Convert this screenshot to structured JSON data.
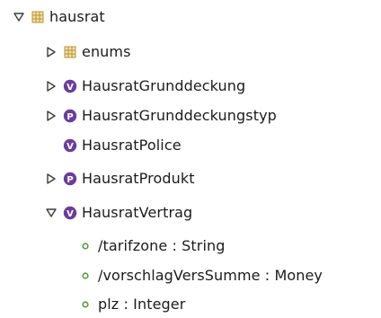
{
  "tree": {
    "root": {
      "label": "hausrat",
      "icon": "package-icon",
      "expanded": true
    },
    "children": [
      {
        "label": "enums",
        "icon": "package-icon",
        "expanded": false,
        "hasChildren": true
      },
      {
        "label": "HausratGrunddeckung",
        "icon": "class-v-icon",
        "expanded": false,
        "hasChildren": true
      },
      {
        "label": "HausratGrunddeckungstyp",
        "icon": "class-p-icon",
        "expanded": false,
        "hasChildren": true
      },
      {
        "label": "HausratPolice",
        "icon": "class-v-icon",
        "expanded": false,
        "hasChildren": false
      },
      {
        "label": "HausratProdukt",
        "icon": "class-p-icon",
        "expanded": false,
        "hasChildren": true
      },
      {
        "label": "HausratVertrag",
        "icon": "class-v-icon",
        "expanded": true,
        "hasChildren": true
      }
    ],
    "attributes": [
      {
        "label": "/tarifzone : String",
        "icon": "attribute-icon"
      },
      {
        "label": "/vorschlagVersSumme : Money",
        "icon": "attribute-icon"
      },
      {
        "label": "plz : Integer",
        "icon": "attribute-icon"
      }
    ]
  },
  "colors": {
    "package_green": "#6aa84f",
    "class_purple": "#6a3e9c",
    "attribute_green": "#5a9b3a",
    "twisty": "#3c3c3c"
  }
}
